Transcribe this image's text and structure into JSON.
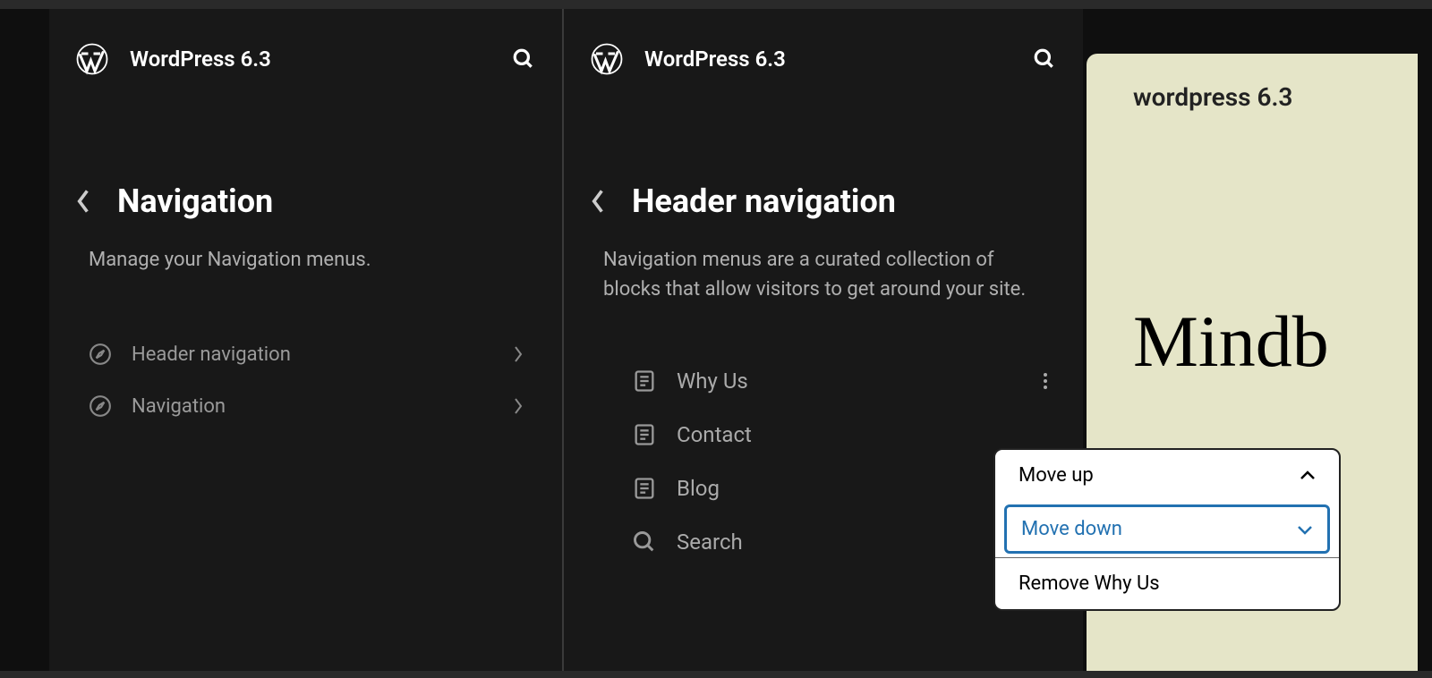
{
  "app_title": "WordPress 6.3",
  "panel_left": {
    "title": "Navigation",
    "description": "Manage your Navigation menus.",
    "items": [
      {
        "label": "Header navigation"
      },
      {
        "label": "Navigation"
      }
    ]
  },
  "panel_right": {
    "title": "Header navigation",
    "description": "Navigation menus are a curated collection of blocks that allow visitors to get around your site.",
    "items": [
      {
        "label": "Why Us",
        "icon": "page"
      },
      {
        "label": "Contact",
        "icon": "page"
      },
      {
        "label": "Blog",
        "icon": "page"
      },
      {
        "label": "Search",
        "icon": "search"
      }
    ]
  },
  "preview": {
    "small_title": "wordpress 6.3",
    "heading": "Mindb"
  },
  "popover": {
    "move_up": "Move up",
    "move_down": "Move down",
    "remove": "Remove Why Us"
  }
}
